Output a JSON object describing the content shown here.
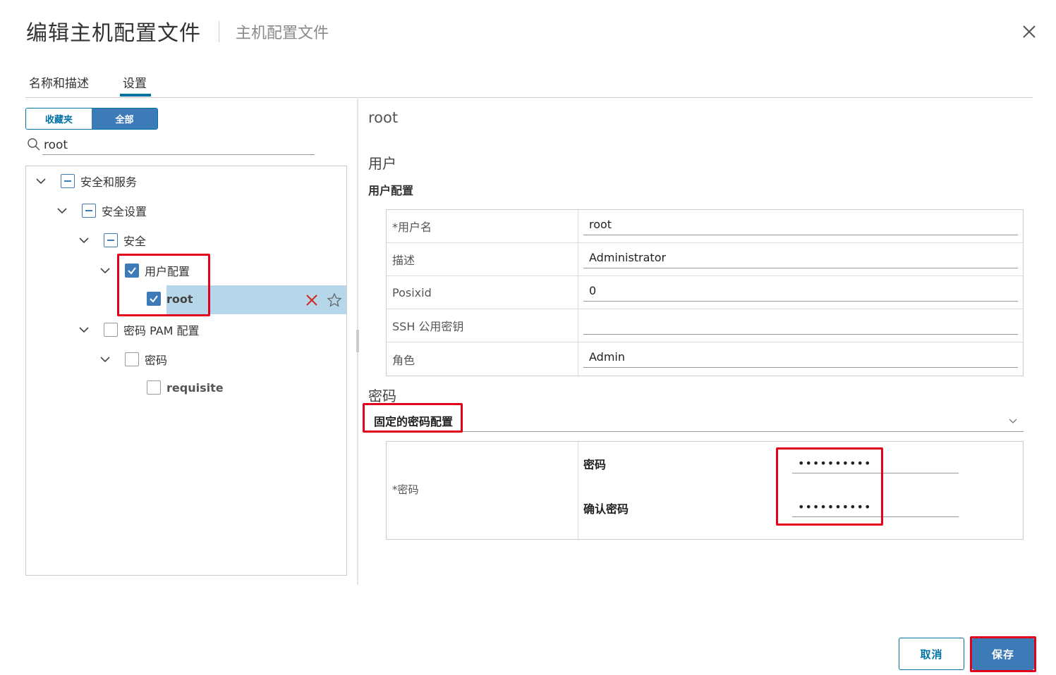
{
  "dialog": {
    "title": "编辑主机配置文件",
    "subtitle": "主机配置文件"
  },
  "tabs": [
    {
      "label": "名称和描述",
      "active": false
    },
    {
      "label": "设置",
      "active": true
    }
  ],
  "filter_toggle": {
    "favorites_label": "收藏夹",
    "all_label": "全部",
    "selected": "全部"
  },
  "search": {
    "value": "root"
  },
  "tree": {
    "n1": "安全和服务",
    "n2": "安全设置",
    "n3": "安全",
    "n4": "用户配置",
    "n5": "root",
    "n6": "密码 PAM 配置",
    "n7": "密码",
    "n8": "requisite"
  },
  "detail": {
    "title": "root",
    "user_section": "用户",
    "user_subsection": "用户配置",
    "fields": [
      {
        "label": "*用户名",
        "value": "root"
      },
      {
        "label": "描述",
        "value": "Administrator"
      },
      {
        "label": "Posixid",
        "value": "0"
      },
      {
        "label": "SSH 公用密钥",
        "value": ""
      },
      {
        "label": "角色",
        "value": "Admin"
      }
    ],
    "password_section": "密码",
    "password_policy": "固定的密码配置",
    "password_field_label": "*密码",
    "password_label": "密码",
    "password_value": "••••••••••",
    "confirm_label": "确认密码",
    "confirm_value": "••••••••••"
  },
  "footer": {
    "cancel_label": "取消",
    "save_label": "保存"
  },
  "colors": {
    "accent": "#0072a3",
    "primary_button": "#3d7ab8",
    "selected_row": "#b6d7ea",
    "highlight_box": "#e3001b"
  }
}
